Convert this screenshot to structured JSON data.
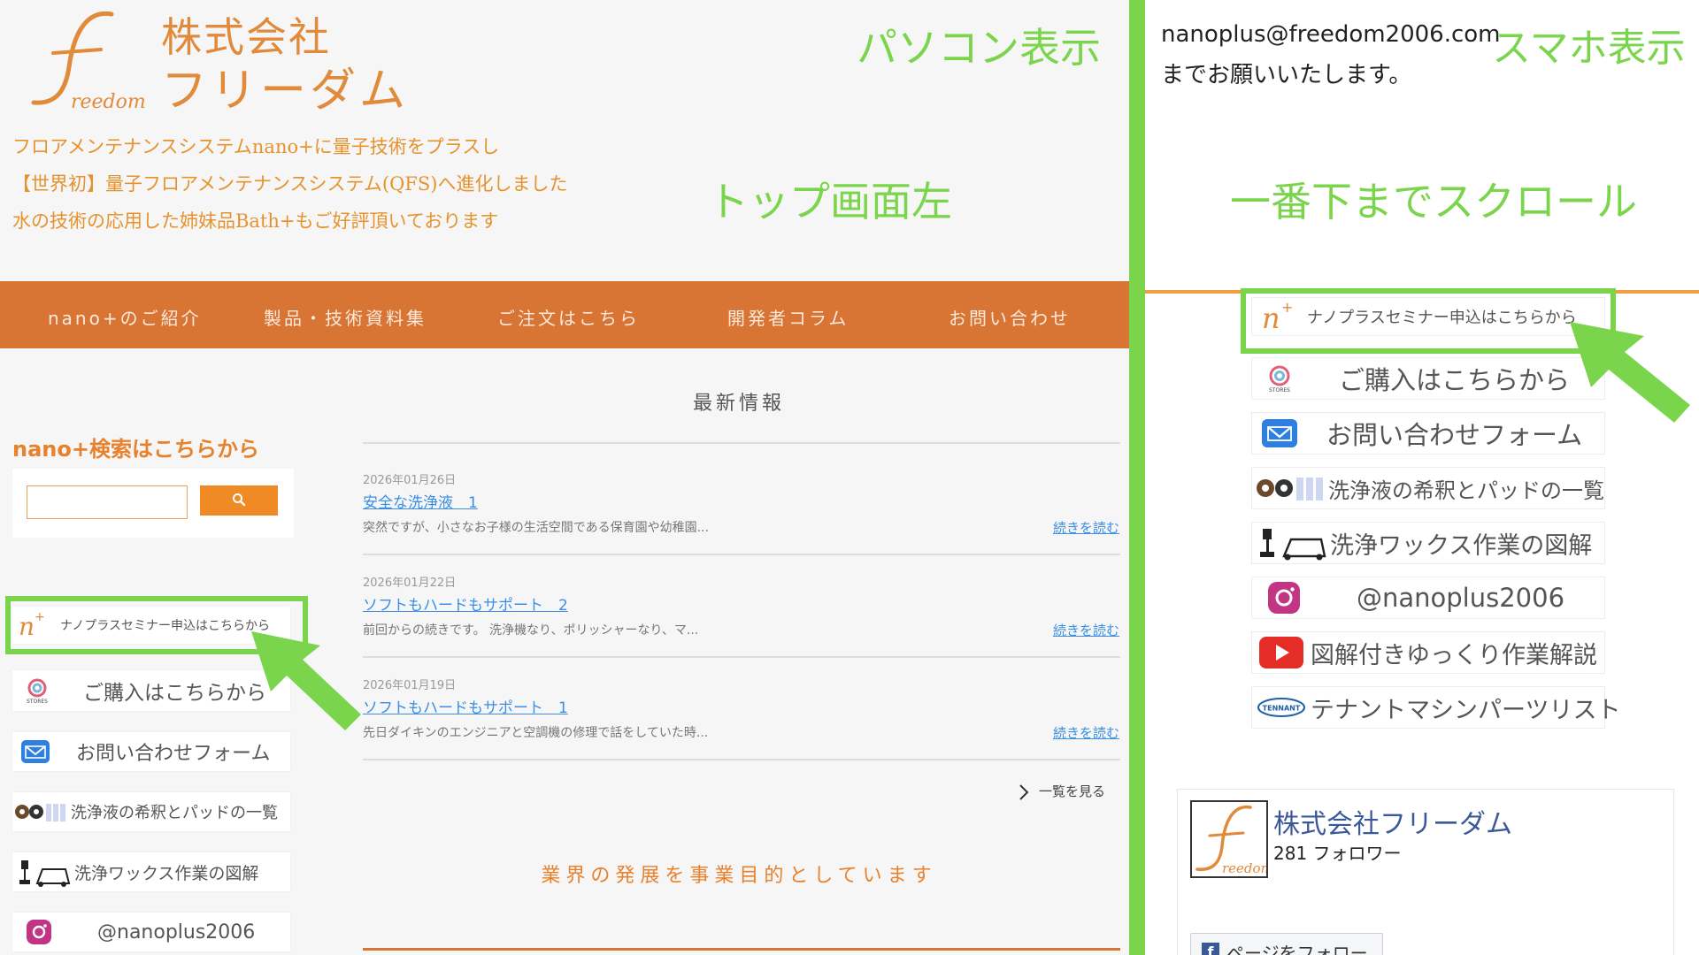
{
  "annotations": {
    "pc_view": "パソコン表示",
    "top_left": "トップ画面左",
    "sp_view": "スマホ表示",
    "scroll": "一番下までスクロール"
  },
  "header": {
    "logo_word": "reedom",
    "company_line1": "株式会社",
    "company_line2": "フリーダム",
    "taglines": [
      "フロアメンテナンスシステムnano+に量子技術をプラスし",
      "【世界初】量子フロアメンテナンスシステム(QFS)へ進化しました",
      "水の技術の応用した姉妹品Bath+もご好評頂いております"
    ]
  },
  "nav": {
    "items": [
      "nano+のご紹介",
      "製品・技術資料集",
      "ご注文はこちら",
      "開発者コラム",
      "お問い合わせ"
    ]
  },
  "sidebar": {
    "search_title": "nano+検索はこちらから",
    "banners": [
      {
        "label": "ナノプラスセミナー申込はこちらから",
        "icon": "nano-plus-logo-icon"
      },
      {
        "label": "ご購入はこちらから",
        "icon": "stores-logo-icon",
        "icon_caption": "STORES"
      },
      {
        "label": "お問い合わせフォーム",
        "icon": "mail-icon"
      },
      {
        "label": "洗浄液の希釈とパッドの一覧",
        "icon": "pads-bottles-icon"
      },
      {
        "label": "洗浄ワックス作業の図解",
        "icon": "cleaning-machine-icon"
      },
      {
        "label": "@nanoplus2006",
        "icon": "instagram-icon"
      }
    ]
  },
  "news": {
    "title": "最新情報",
    "items": [
      {
        "date": "2026年01月26日",
        "title": "安全な洗浄液　1",
        "excerpt": "突然ですが、小さなお子様の生活空間である保育園や幼稚園...",
        "more": "続きを読む"
      },
      {
        "date": "2026年01月22日",
        "title": "ソフトもハードもサポート　2",
        "excerpt": "前回からの続きです。 洗浄機なり、ポリッシャーなり、マ...",
        "more": "続きを読む"
      },
      {
        "date": "2026年01月19日",
        "title": "ソフトもハードもサポート　1",
        "excerpt": "先日ダイキンのエンジニアと空調機の修理で話をしていた時...",
        "more": "続きを読む"
      }
    ],
    "see_all": "一覧を見る",
    "mission": "業界の発展を事業目的としています"
  },
  "sp": {
    "email": "nanoplus@freedom2006.com",
    "email_suffix": "までお願いいたします。",
    "banners": [
      {
        "label": "ナノプラスセミナー申込はこちらから",
        "icon": "nano-plus-logo-icon"
      },
      {
        "label": "ご購入はこちらから",
        "icon": "stores-logo-icon",
        "icon_caption": "STORES"
      },
      {
        "label": "お問い合わせフォーム",
        "icon": "mail-icon"
      },
      {
        "label": "洗浄液の希釈とパッドの一覧",
        "icon": "pads-bottles-icon"
      },
      {
        "label": "洗浄ワックス作業の図解",
        "icon": "cleaning-machine-icon"
      },
      {
        "label": "@nanoplus2006",
        "icon": "instagram-icon"
      },
      {
        "label": "図解付きゆっくり作業解説",
        "icon": "youtube-icon"
      },
      {
        "label": "テナントマシンパーツリスト",
        "icon": "tennant-logo-icon",
        "icon_caption": "TENNANT"
      }
    ],
    "facebook": {
      "name": "株式会社フリーダム",
      "followers": "281 フォロワー",
      "follow_button": "ページをフォロー",
      "logo_word": "reedom"
    }
  },
  "colors": {
    "accent_orange": "#d97534",
    "annotation_green": "#7ad54c",
    "link_blue": "#3a8ee6"
  }
}
